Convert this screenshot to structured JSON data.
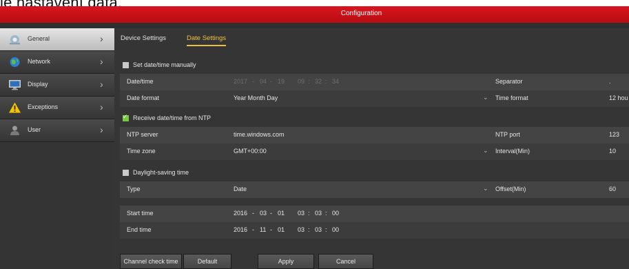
{
  "outer_text": "le nastavení data.",
  "window": {
    "title": "Configuration"
  },
  "sidebar": {
    "items": [
      {
        "label": "General",
        "icon": "general-icon",
        "active": true
      },
      {
        "label": "Network",
        "icon": "network-globe-icon",
        "active": false
      },
      {
        "label": "Display",
        "icon": "display-monitor-icon",
        "active": false
      },
      {
        "label": "Exceptions",
        "icon": "warning-icon",
        "active": false
      },
      {
        "label": "User",
        "icon": "user-icon",
        "active": false
      }
    ],
    "chevron": "›"
  },
  "tabs": [
    {
      "label": "Device Settings",
      "active": false
    },
    {
      "label": "Date Settings",
      "active": true
    }
  ],
  "manual": {
    "label": "Set date/time manually",
    "checked": false,
    "datetime_label": "Date/time",
    "date": {
      "year": "2017",
      "month": "04",
      "day": "19"
    },
    "time": {
      "hour": "09",
      "minute": "32",
      "second": "34"
    },
    "date_sep": "-",
    "time_sep": ":",
    "separator_label": "Separator",
    "separator_value": ".",
    "date_format_label": "Date format",
    "date_format_value": "Year Month Day",
    "time_format_label": "Time format",
    "time_format_value": "12 hou"
  },
  "ntp": {
    "label": "Receive date/time from NTP",
    "checked": true,
    "server_label": "NTP server",
    "server_value": "time.windows.com",
    "port_label": "NTP port",
    "port_value": "123",
    "timezone_label": "Time zone",
    "timezone_value": "GMT+00:00",
    "interval_label": "Interval(Min)",
    "interval_value": "10"
  },
  "dst": {
    "label": "Daylight-saving time",
    "checked": false,
    "type_label": "Type",
    "type_value": "Date",
    "offset_label": "Offset(Min)",
    "offset_value": "60",
    "start_label": "Start time",
    "start_date": {
      "year": "2016",
      "month": "03",
      "day": "01"
    },
    "start_time": {
      "hour": "03",
      "minute": "03",
      "second": "00"
    },
    "end_label": "End time",
    "end_date": {
      "year": "2016",
      "month": "11",
      "day": "01"
    },
    "end_time": {
      "hour": "03",
      "minute": "03",
      "second": "00"
    }
  },
  "dropdown_arrow": "⌄",
  "buttons": {
    "channel_check": "Channel check time",
    "default": "Default",
    "apply": "Apply",
    "cancel": "Cancel"
  },
  "colors": {
    "titlebar": "#c8111a",
    "tab_active": "#f0c040",
    "checkbox_checked": "#7ac943",
    "warning": "#f5c400"
  }
}
